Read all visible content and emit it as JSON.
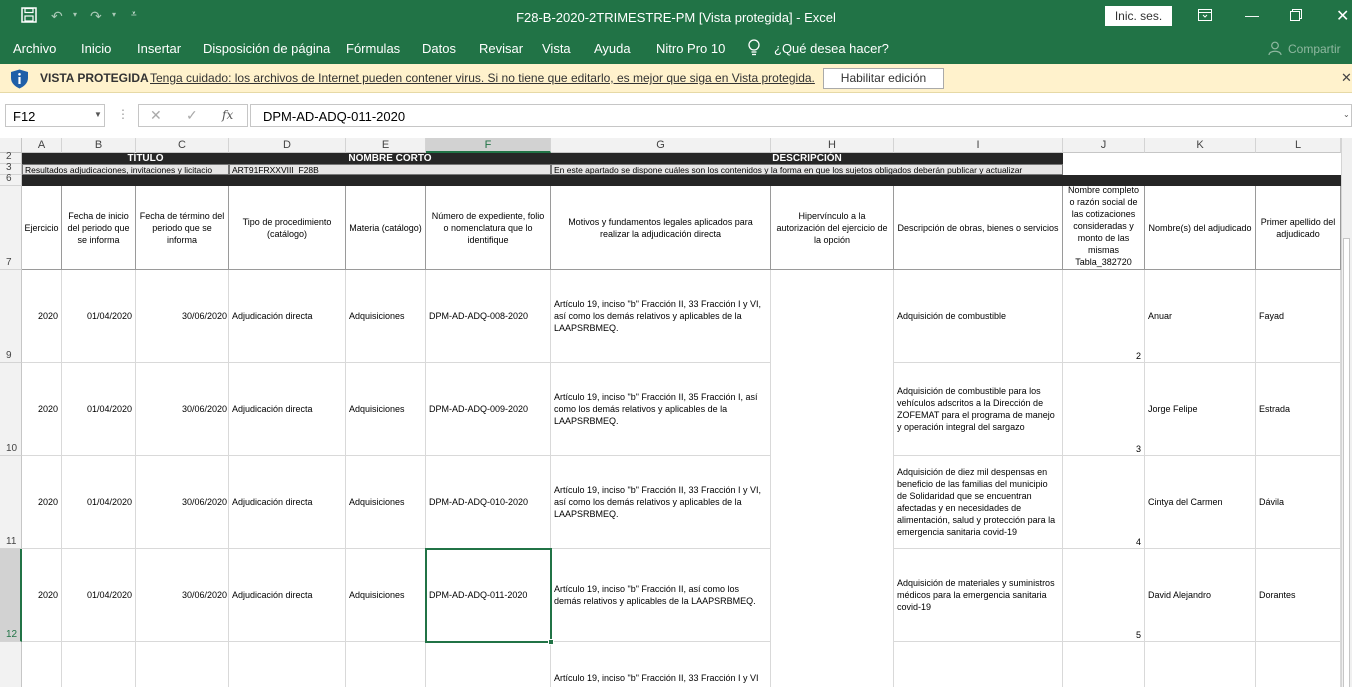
{
  "app": {
    "window_title": "F28-B-2020-2TRIMESTRE-PM  [Vista protegida]  -  Excel",
    "signin_label": "Inic. ses.",
    "share_label": "Compartir"
  },
  "menu": [
    "Archivo",
    "Inicio",
    "Insertar",
    "Disposición de página",
    "Fórmulas",
    "Datos",
    "Revisar",
    "Vista",
    "Ayuda",
    "Nitro Pro 10"
  ],
  "tell_me": "¿Qué desea hacer?",
  "protected": {
    "title": "VISTA PROTEGIDA",
    "message": "Tenga cuidado: los archivos de Internet pueden contener virus. Si no tiene que editarlo, es mejor que siga en Vista protegida.",
    "button": "Habilitar edición"
  },
  "formula": {
    "name_box": "F12",
    "fx": "fx",
    "value": "DPM-AD-ADQ-011-2020"
  },
  "columns": [
    "A",
    "B",
    "C",
    "D",
    "E",
    "F",
    "G",
    "H",
    "I",
    "J",
    "K",
    "L"
  ],
  "rows": {
    "r2": "2",
    "r3": "3",
    "r6": "6",
    "r7": "7",
    "r9": "9",
    "r10": "10",
    "r11": "11",
    "r12": "12"
  },
  "row2": {
    "titulo": "TÍTULO",
    "nombre_corto": "NOMBRE CORTO",
    "descripcion": "DESCRIPCIÓN"
  },
  "row3": {
    "titulo": "Resultados adjudicaciones, invitaciones y licitacio",
    "nombre_corto": "ART91FRXXVIII_F28B",
    "descripcion": "En este apartado se dispone cuáles son los contenidos y la forma en que los sujetos obligados deberán publicar y actualizar"
  },
  "headers": {
    "A": "Ejercicio",
    "B": "Fecha de inicio del periodo que se informa",
    "C": "Fecha de término del periodo que se informa",
    "D": "Tipo de procedimiento (catálogo)",
    "E": "Materia (catálogo)",
    "F": "Número de expediente, folio o nomenclatura que lo identifique",
    "G": "Motivos y fundamentos legales aplicados para realizar la adjudicación directa",
    "H": "Hipervínculo a la autorización del ejercicio de la opción",
    "I": "Descripción de obras, bienes o servicios",
    "J": "Nombre completo o razón social de las cotizaciones consideradas y monto de las mismas\nTabla_382720",
    "K": "Nombre(s) del adjudicado",
    "L": "Primer apellido del adjudicado"
  },
  "data_rows": [
    {
      "ejercicio": "2020",
      "inicio": "01/04/2020",
      "termino": "30/06/2020",
      "tipo": "Adjudicación directa",
      "materia": "Adquisiciones",
      "expediente": "DPM-AD-ADQ-008-2020",
      "motivos": "Artículo 19, inciso \"b\" Fracción II, 33 Fracción I y VI, así como los demás relativos y aplicables de la LAAPSRBMEQ.",
      "hipervinculo": "",
      "descripcion": "Adquisición de combustible",
      "tabla": "2",
      "nombre": "Anuar",
      "apellido": "Fayad"
    },
    {
      "ejercicio": "2020",
      "inicio": "01/04/2020",
      "termino": "30/06/2020",
      "tipo": "Adjudicación directa",
      "materia": "Adquisiciones",
      "expediente": "DPM-AD-ADQ-009-2020",
      "motivos": "Artículo 19, inciso \"b\" Fracción II, 35 Fracción I, así como los demás relativos y aplicables de la LAAPSRBMEQ.",
      "hipervinculo": "",
      "descripcion": "Adquisición de combustible para los vehículos adscritos a la Dirección de ZOFEMAT para el programa de manejo y operación integral del sargazo",
      "tabla": "3",
      "nombre": "Jorge Felipe",
      "apellido": "Estrada"
    },
    {
      "ejercicio": "2020",
      "inicio": "01/04/2020",
      "termino": "30/06/2020",
      "tipo": "Adjudicación directa",
      "materia": "Adquisiciones",
      "expediente": "DPM-AD-ADQ-010-2020",
      "motivos": "Artículo 19, inciso \"b\" Fracción II, 33 Fracción I y VI, así como los demás relativos y aplicables de la LAAPSRBMEQ.",
      "hipervinculo": "",
      "descripcion": "Adquisición de diez mil despensas en beneficio de las familias del municipio de Solidaridad que se encuentran afectadas y en necesidades de alimentación, salud y protección para la emergencia sanitaria covid-19",
      "tabla": "4",
      "nombre": "Cintya del Carmen",
      "apellido": "Dávila"
    },
    {
      "ejercicio": "2020",
      "inicio": "01/04/2020",
      "termino": "30/06/2020",
      "tipo": "Adjudicación directa",
      "materia": "Adquisiciones",
      "expediente": "DPM-AD-ADQ-011-2020",
      "motivos": "Artículo 19, inciso \"b\" Fracción II, así como los demás relativos y aplicables de la LAAPSRBMEQ.",
      "hipervinculo": "",
      "descripcion": "Adquisición de materiales y suministros médicos para la emergencia sanitaria covid-19",
      "tabla": "5",
      "nombre": "David Alejandro",
      "apellido": "Dorantes"
    }
  ],
  "partial_row": {
    "motivos": "Artículo 19, inciso \"b\" Fracción II, 33 Fracción I y VI"
  }
}
